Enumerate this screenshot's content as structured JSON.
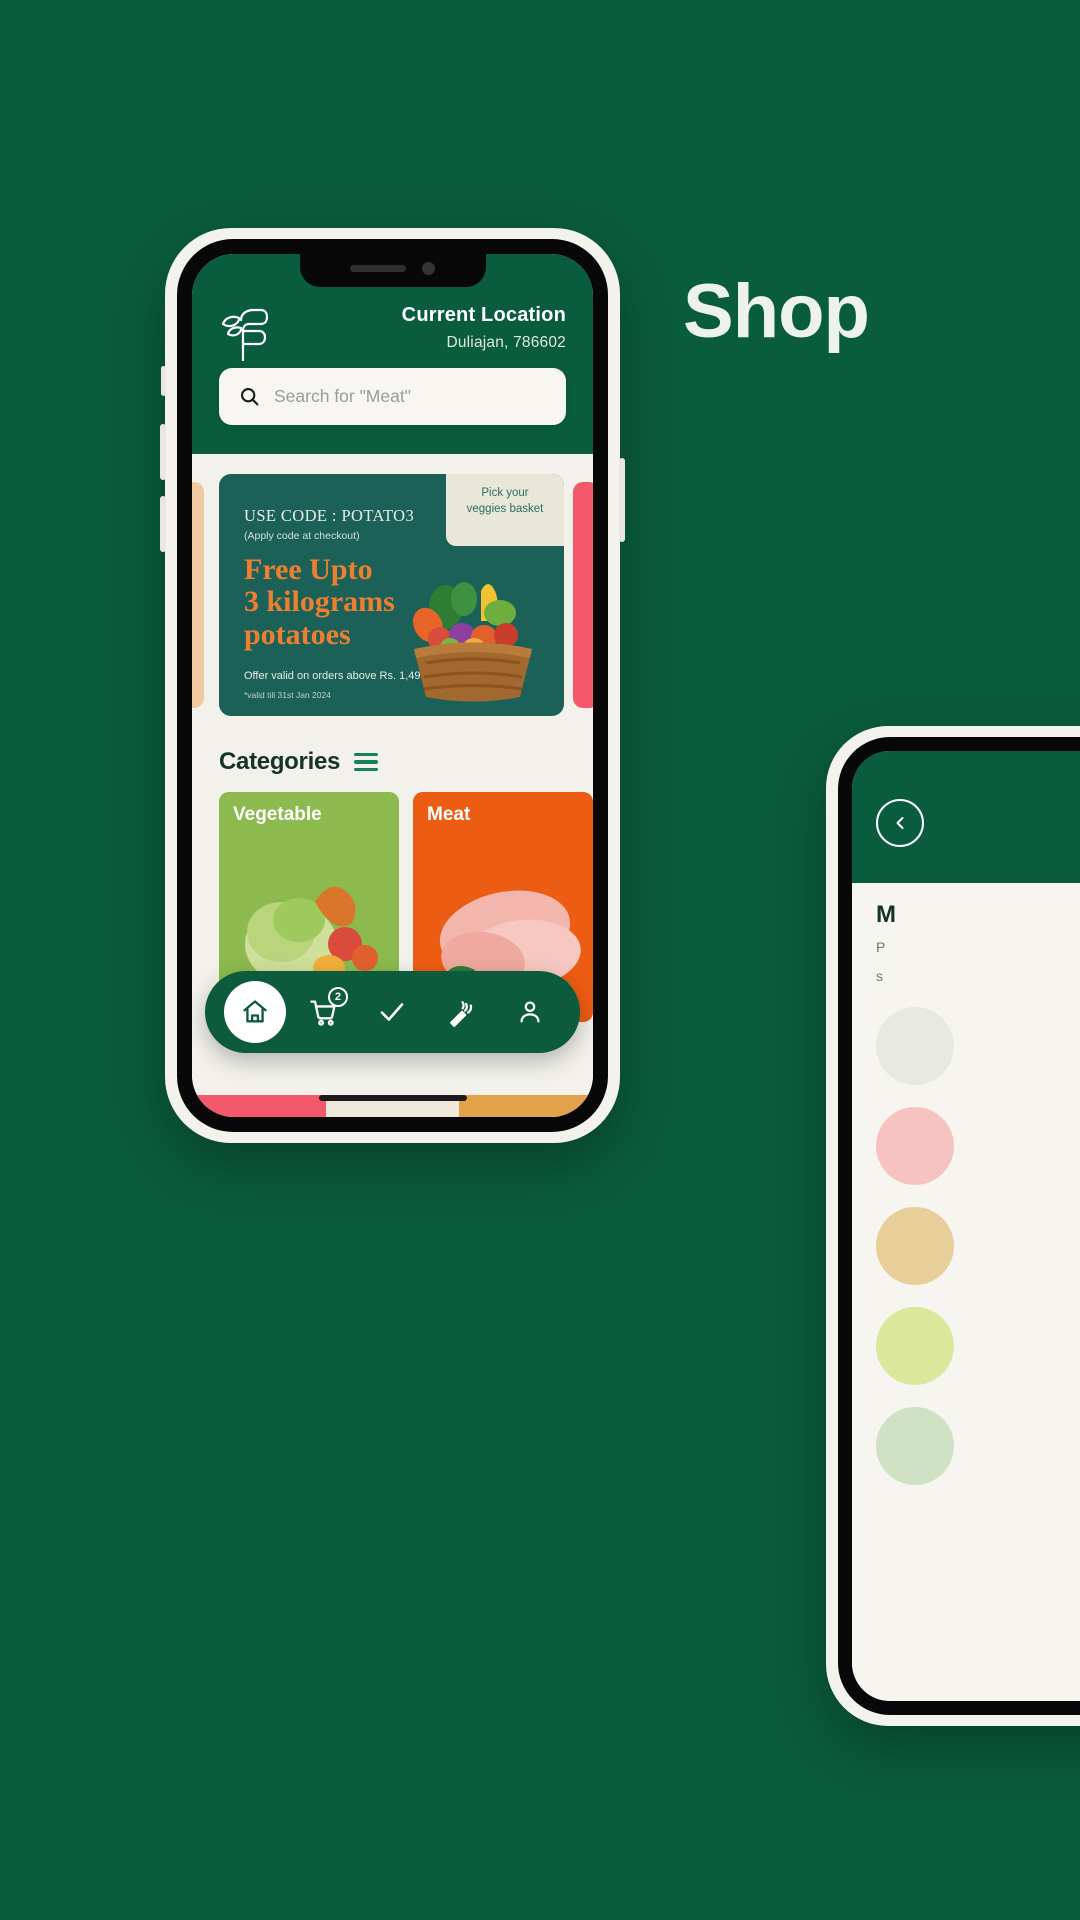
{
  "page": {
    "background_color": "#0a5c3e",
    "headline": "Shop",
    "accent_green": "#0a5c3e",
    "accent_orange": "#ef7f30",
    "card_green": "#8cba4e",
    "card_orange": "#ed5c13"
  },
  "phone1": {
    "header": {
      "logo_icon": "leaf-f-logo-icon",
      "location_label": "Current Location",
      "location_value": "Duliajan, 786602"
    },
    "search": {
      "icon": "search-icon",
      "placeholder": "Search for \"Meat\"",
      "value": ""
    },
    "promo": {
      "code_line": "USE CODE : POTATO3",
      "code_note": "(Apply code at checkout)",
      "headline_l1": "Free Upto",
      "headline_l2": "3 kilograms",
      "headline_l3": "potatoes",
      "basket_tag_l1": "Pick your",
      "basket_tag_l2": "veggies basket",
      "footnote": "Offer valid on orders above Rs. 1,499",
      "validity": "*valid till 31st Jan 2024",
      "bg_color": "#1c6158"
    },
    "categories": {
      "title": "Categories",
      "menu_icon": "hamburger-menu-icon",
      "cards": [
        {
          "label": "Vegetable",
          "color": "#8cba4e"
        },
        {
          "label": "Meat",
          "color": "#ed5c13"
        }
      ]
    },
    "bottom_nav": {
      "items": [
        {
          "name": "home",
          "icon": "home-icon",
          "active": true,
          "badge": ""
        },
        {
          "name": "cart",
          "icon": "shopping-cart-icon",
          "active": false,
          "badge": "2"
        },
        {
          "name": "orders",
          "icon": "check-icon",
          "active": false,
          "badge": ""
        },
        {
          "name": "offers",
          "icon": "carrot-icon",
          "active": false,
          "badge": ""
        },
        {
          "name": "profile",
          "icon": "person-icon",
          "active": false,
          "badge": ""
        }
      ]
    }
  },
  "phone2": {
    "back_icon": "back-arrow-icon",
    "title": "M",
    "desc_l1": "P",
    "desc_l2": "s"
  }
}
